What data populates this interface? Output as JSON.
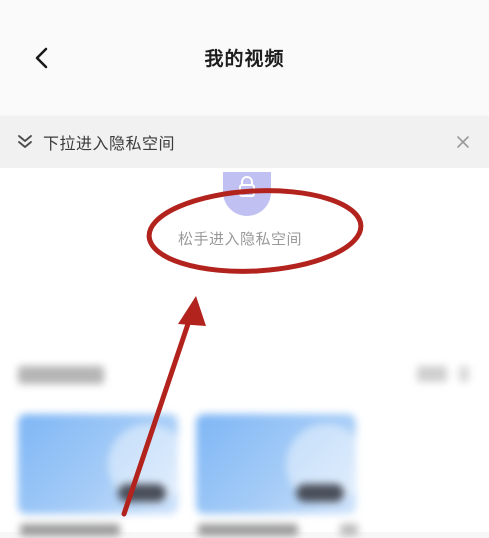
{
  "header": {
    "title": "我的视频",
    "back_icon": "back-chevron-icon"
  },
  "banner": {
    "text": "下拉进入隐私空间",
    "chevrons_icon": "double-chevron-down-icon",
    "close_icon": "close-icon"
  },
  "privacy": {
    "release_text": "松手进入隐私空间",
    "lock_icon": "lock-icon"
  },
  "colors": {
    "annotation_red": "#b3231e",
    "lock_accent": "#b7b6f0",
    "thumb_blue": "#7eb6f5"
  }
}
